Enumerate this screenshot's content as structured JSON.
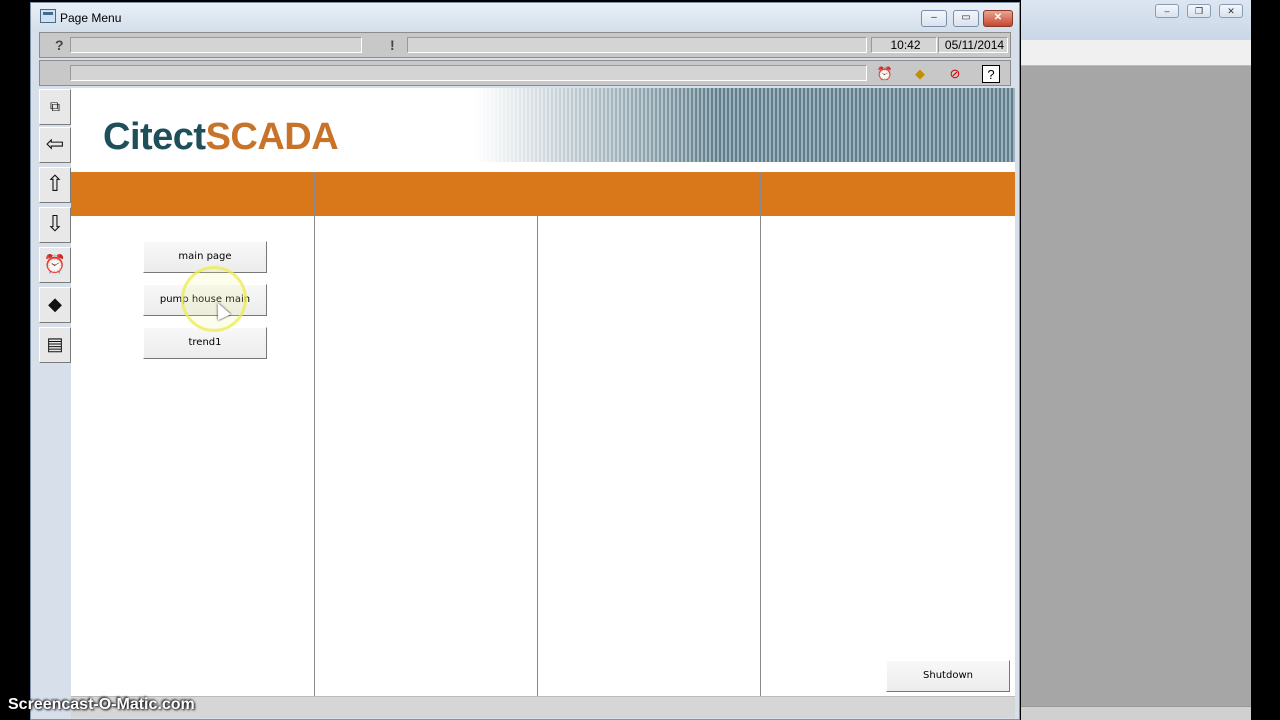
{
  "window": {
    "title": "Page Menu",
    "controls": {
      "minimize": "‒",
      "maximize": "▭",
      "close": "✕"
    }
  },
  "toolbar": {
    "help_mark": "?",
    "alert_mark": "!",
    "time": "10:42",
    "date": "05/11/2014",
    "icons": [
      "alarm-clock-icon",
      "warning-icon",
      "cancel-icon",
      "help-pointer-icon"
    ]
  },
  "nav": {
    "items": [
      {
        "name": "copy-icon",
        "glyph": "⧉"
      },
      {
        "name": "back-icon",
        "glyph": "⇦"
      },
      {
        "name": "up-icon",
        "glyph": "⇧"
      },
      {
        "name": "down-icon",
        "glyph": "⇩"
      },
      {
        "name": "alarm-clock-icon",
        "glyph": "⏰"
      },
      {
        "name": "warning-icon",
        "glyph": "◆"
      },
      {
        "name": "report-icon",
        "glyph": "▤"
      }
    ]
  },
  "header": {
    "logo_part1": "Citect",
    "logo_part2": "SCADA"
  },
  "colors": {
    "accent": "#d8781a",
    "logo_dark": "#1f4f5a",
    "logo_orange": "#c8732a"
  },
  "page_buttons": [
    "main page",
    "pump house main",
    "trend1"
  ],
  "shutdown_label": "Shutdown",
  "watermark": "Screencast-O-Matic.com"
}
